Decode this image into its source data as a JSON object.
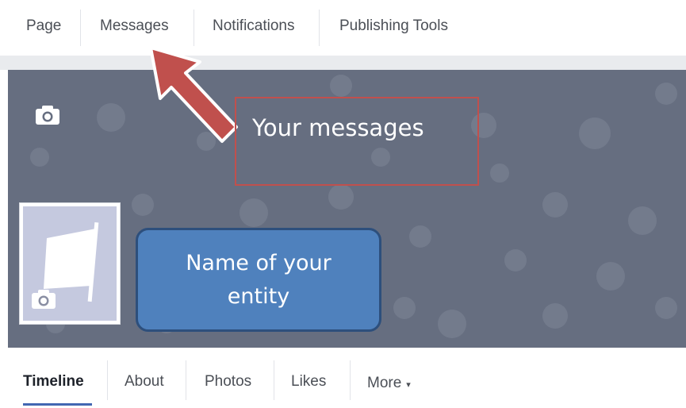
{
  "top_nav": {
    "tabs": [
      {
        "label": "Page"
      },
      {
        "label": "Messages"
      },
      {
        "label": "Notifications"
      },
      {
        "label": "Publishing Tools"
      }
    ]
  },
  "annotations": {
    "messages_callout": "Your messages",
    "name_callout_line1": "Name of your",
    "name_callout_line2": "entity"
  },
  "bottom_nav": {
    "tabs": [
      {
        "label": "Timeline"
      },
      {
        "label": "About"
      },
      {
        "label": "Photos"
      },
      {
        "label": "Likes"
      },
      {
        "label": "More"
      }
    ],
    "more_caret": "▾"
  },
  "icons": {
    "cover_camera": "camera-icon",
    "profile_camera": "camera-icon",
    "profile_placeholder": "flag-icon",
    "arrow": "arrow-up-left-icon"
  },
  "colors": {
    "cover_bg": "#666e80",
    "profile_bg": "#c5c9df",
    "callout_border": "#c0504d",
    "callout_blue": "#4f81bd",
    "arrow": "#c0504d",
    "active_underline": "#4267b2"
  }
}
